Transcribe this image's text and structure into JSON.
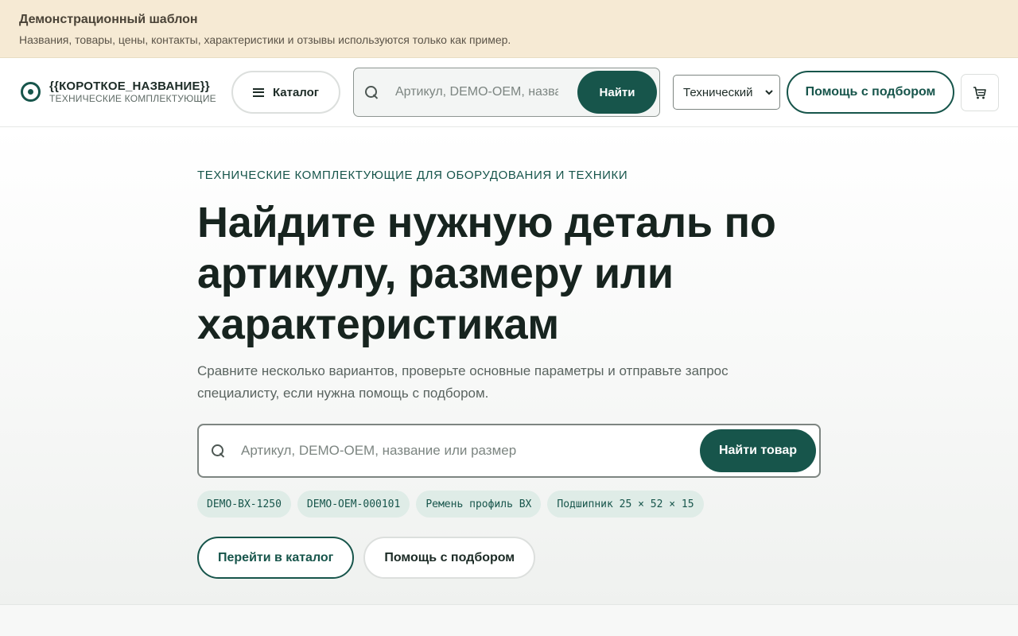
{
  "banner": {
    "title": "Демонстрационный шаблон",
    "text": "Названия, товары, цены, контакты, характеристики и отзывы используются только как пример."
  },
  "header": {
    "logo_name": "{{КОРОТКОЕ_НАЗВАНИЕ}}",
    "logo_sub": "ТЕХНИЧЕСКИЕ КОМПЛЕКТУЮЩИЕ",
    "catalog_label": "Каталог",
    "search_placeholder": "Артикул, DEMO-OEM, название или размер",
    "search_button": "Найти",
    "type_select_value": "Технический",
    "help_button": "Помощь с подбором"
  },
  "hero": {
    "eyebrow": "ТЕХНИЧЕСКИЕ КОМПЛЕКТУЮЩИЕ ДЛЯ ОБОРУДОВАНИЯ И ТЕХНИКИ",
    "title": "Найдите нужную деталь по артикулу, размеру или характеристикам",
    "description": "Сравните несколько вариантов, проверьте основные параметры и отправьте запрос специалисту, если нужна помощь с подбором.",
    "search_placeholder": "Артикул, DEMO-OEM, название или размер",
    "search_button": "Найти товар",
    "chips": [
      "DEMO-BX-1250",
      "DEMO-OEM-000101",
      "Ремень профиль BX",
      "Подшипник 25 × 52 × 15"
    ],
    "catalog_button": "Перейти в каталог",
    "help_button": "Помощь с подбором"
  },
  "colors": {
    "accent": "#17554b",
    "banner_bg": "#f6ead4",
    "chip_bg": "#dfece7"
  },
  "icons": [
    "logo-icon",
    "menu-icon",
    "search-icon",
    "chevron-down-icon",
    "cart-icon"
  ]
}
